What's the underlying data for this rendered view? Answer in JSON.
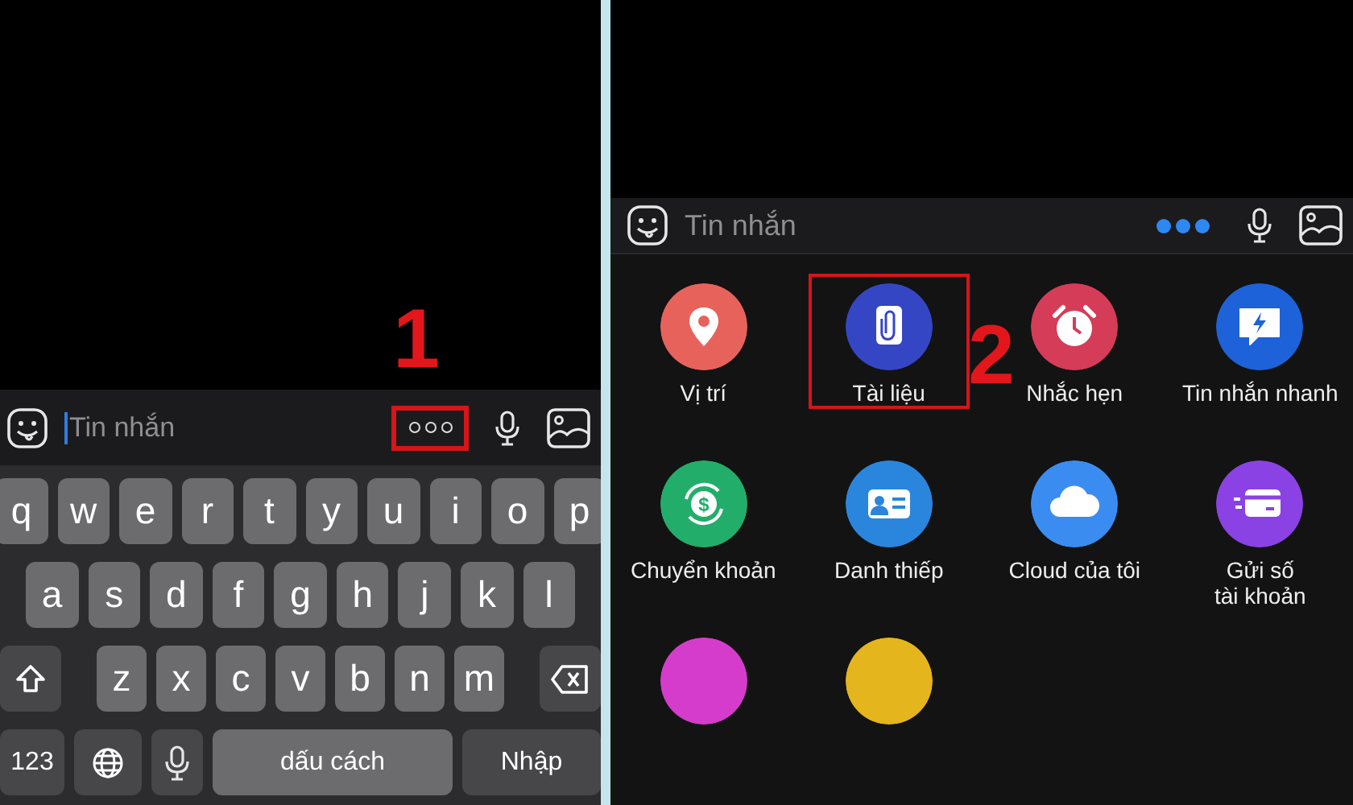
{
  "screens": [
    {
      "kind": "keyboard",
      "step_label": "1",
      "message_bar": {
        "placeholder": "Tin nhắn",
        "focused": true,
        "more_active": false,
        "more_highlighted": true
      },
      "keyboard": [
        [
          {
            "kind": "letter",
            "label": "q"
          },
          {
            "kind": "letter",
            "label": "w"
          },
          {
            "kind": "letter",
            "label": "e"
          },
          {
            "kind": "letter",
            "label": "r"
          },
          {
            "kind": "letter",
            "label": "t"
          },
          {
            "kind": "letter",
            "label": "y"
          },
          {
            "kind": "letter",
            "label": "u"
          },
          {
            "kind": "letter",
            "label": "i"
          },
          {
            "kind": "letter",
            "label": "o"
          },
          {
            "kind": "letter",
            "label": "p"
          }
        ],
        [
          {
            "kind": "letter",
            "label": "a"
          },
          {
            "kind": "letter",
            "label": "s"
          },
          {
            "kind": "letter",
            "label": "d"
          },
          {
            "kind": "letter",
            "label": "f"
          },
          {
            "kind": "letter",
            "label": "g"
          },
          {
            "kind": "letter",
            "label": "h"
          },
          {
            "kind": "letter",
            "label": "j"
          },
          {
            "kind": "letter",
            "label": "k"
          },
          {
            "kind": "letter",
            "label": "l"
          }
        ],
        [
          {
            "kind": "shift"
          },
          {
            "kind": "letter",
            "label": "z"
          },
          {
            "kind": "letter",
            "label": "x"
          },
          {
            "kind": "letter",
            "label": "c"
          },
          {
            "kind": "letter",
            "label": "v"
          },
          {
            "kind": "letter",
            "label": "b"
          },
          {
            "kind": "letter",
            "label": "n"
          },
          {
            "kind": "letter",
            "label": "m"
          },
          {
            "kind": "backspace"
          }
        ],
        [
          {
            "kind": "numbers",
            "label": "123"
          },
          {
            "kind": "globe"
          },
          {
            "kind": "mic"
          },
          {
            "kind": "space",
            "label": "dấu cách"
          },
          {
            "kind": "return",
            "label": "Nhập"
          }
        ]
      ]
    },
    {
      "kind": "apps",
      "step_label": "2",
      "message_bar": {
        "placeholder": "Tin nhắn",
        "focused": false,
        "more_active": true,
        "more_highlighted": false
      },
      "apps": [
        {
          "label": "Vị trí",
          "kind": "location",
          "color": "#e8625c",
          "highlighted": false
        },
        {
          "label": "Tài liệu",
          "kind": "document",
          "color": "#3546c4",
          "highlighted": true
        },
        {
          "label": "Nhắc hẹn",
          "kind": "alarm",
          "color": "#d43c58",
          "highlighted": false
        },
        {
          "label": "Tin nhắn nhanh",
          "kind": "quick",
          "color": "#1d62d8",
          "highlighted": false
        },
        {
          "label": "Chuyển khoản",
          "kind": "transfer",
          "symbol": "$",
          "color": "#22ae6a",
          "highlighted": false
        },
        {
          "label": "Danh thiếp",
          "kind": "card",
          "color": "#2a86dc",
          "highlighted": false
        },
        {
          "label": "Cloud của tôi",
          "kind": "cloud",
          "color": "#3a8cf0",
          "highlighted": false
        },
        {
          "label": "Gửi số\ntài khoản",
          "kind": "account",
          "color": "#8a42e4",
          "highlighted": false
        },
        {
          "color": "#d63ccb",
          "highlighted": false
        },
        {
          "color": "#e4b51c",
          "highlighted": false
        }
      ]
    }
  ]
}
